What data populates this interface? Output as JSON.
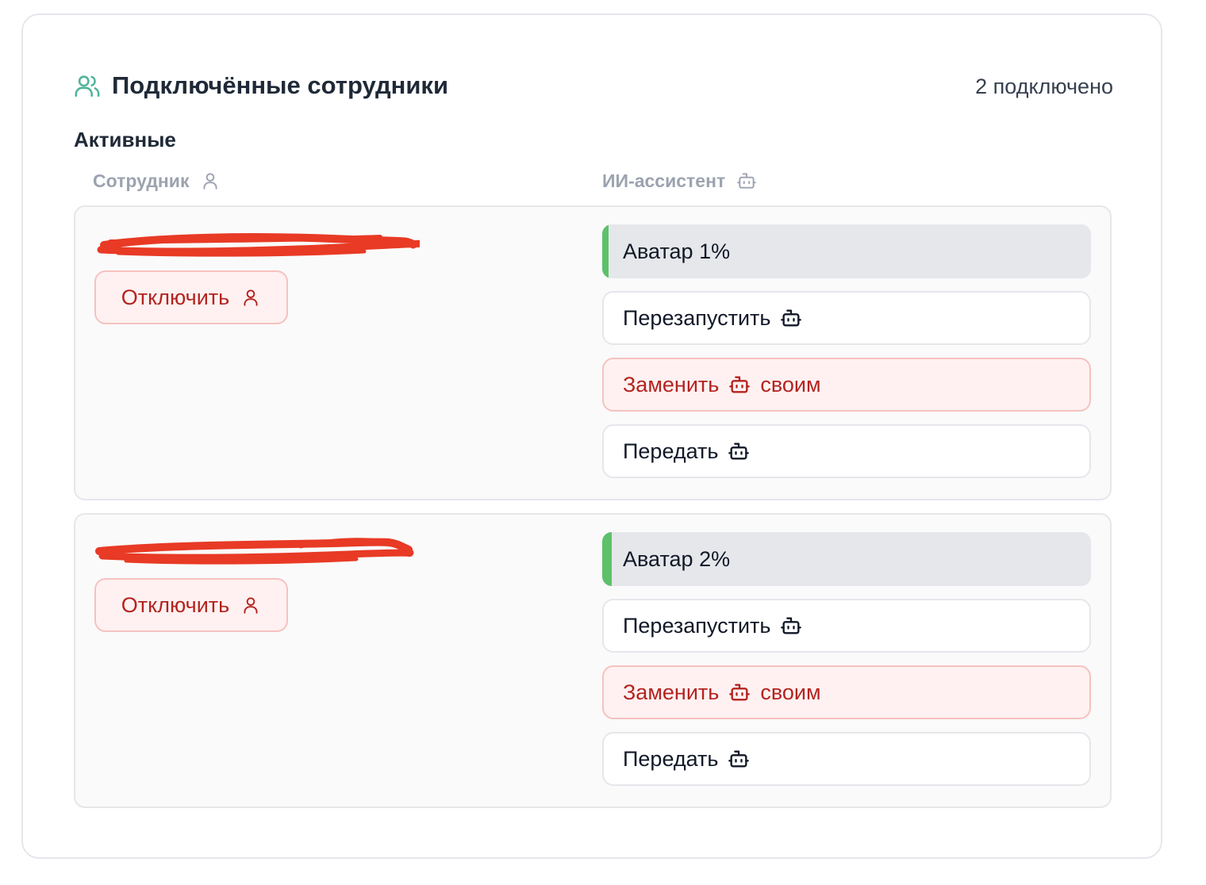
{
  "header": {
    "title": "Подключённые сотрудники",
    "count": "2 подключено"
  },
  "section": {
    "title": "Активные"
  },
  "columns": {
    "employee": "Сотрудник",
    "assistant": "ИИ-ассистент"
  },
  "employees": [
    {
      "disconnect_label": "Отключить",
      "avatar_label": "Аватар 1%",
      "avatar_progress_percent": 1,
      "restart_label": "Перезапустить",
      "replace_label": "Заменить",
      "replace_suffix": "своим",
      "transfer_label": "Передать"
    },
    {
      "disconnect_label": "Отключить",
      "avatar_label": "Аватар 2%",
      "avatar_progress_percent": 2,
      "restart_label": "Перезапустить",
      "replace_label": "Заменить",
      "replace_suffix": "своим",
      "transfer_label": "Передать"
    }
  ],
  "colors": {
    "accent_icon": "#4fb39a",
    "danger": "#b4231f",
    "progress": "#5dc16a",
    "redaction": "#e83a25"
  },
  "icons": {
    "header": "users-icon",
    "employee": "user-icon",
    "assistant": "bot-icon"
  }
}
